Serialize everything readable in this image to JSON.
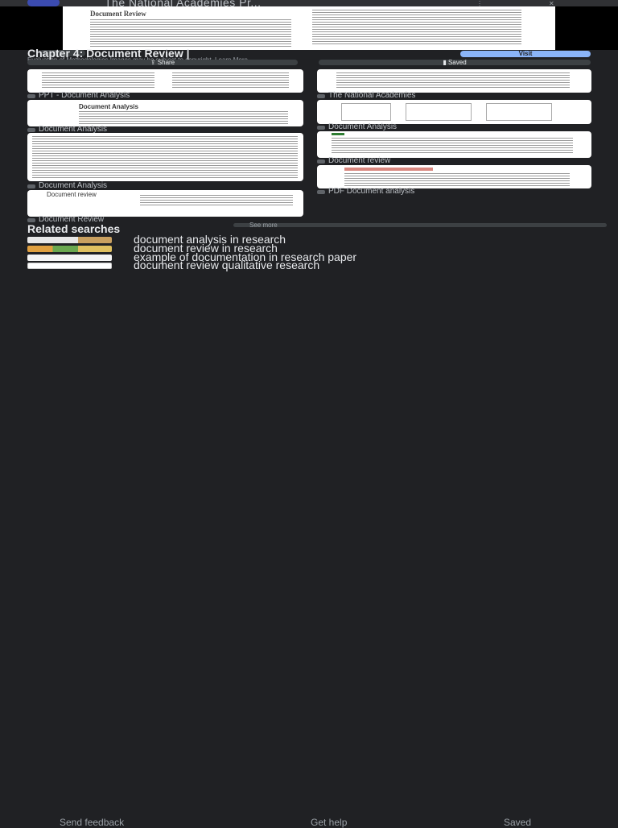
{
  "source": {
    "title": "The National Academies Pr...",
    "logo": "N"
  },
  "preview": {
    "heading": "Document Review"
  },
  "result": {
    "title": "Chapter 4: Document Review |",
    "subtitle": "Evaluation of Methodologies Images may be subject to copyright. Learn More",
    "visit_label": "Visit",
    "share_label": "Share",
    "save_label": "Saved"
  },
  "cards": [
    {
      "caption": "PPT - Document Analysis"
    },
    {
      "caption": "The National Academies"
    },
    {
      "caption": "Document Analysis"
    },
    {
      "caption": "Document Analysis"
    },
    {
      "caption": "Document Analysis"
    },
    {
      "caption": "Document review"
    },
    {
      "caption": "Document review"
    },
    {
      "caption": "PDF Document analysis"
    },
    {
      "caption": "Document Review"
    }
  ],
  "related": {
    "header": "Related searches",
    "see_more": "See more",
    "items": [
      {
        "label": "document analysis in research"
      },
      {
        "label": "document review in research"
      },
      {
        "label": "example of documentation in research paper"
      },
      {
        "label": "document review qualitative research"
      }
    ]
  },
  "footer": {
    "send_feedback": "Send feedback",
    "get_help": "Get help",
    "saved": "Saved"
  }
}
